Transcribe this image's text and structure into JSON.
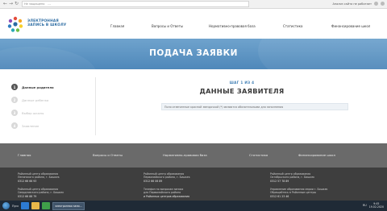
{
  "browser": {
    "back_icon": "arrow-left-icon",
    "forward_icon": "arrow-right-icon",
    "refresh_icon": "refresh-icon",
    "url_prefix": "Не защищено",
    "url": "...",
    "extension_label": "Анализ сайта не работает"
  },
  "logo": {
    "line1": "ЭЛЕКТРОННАЯ",
    "line2": "ЗАПИСЬ В ШКОЛУ"
  },
  "top_nav": [
    "Главная",
    "Вопросы и Ответы",
    "Нормативно-правовая база",
    "Статистика",
    "Финансирование школ"
  ],
  "banner": {
    "title": "ПОДАЧА ЗАЯВКИ"
  },
  "steps": [
    {
      "num": "1",
      "label": "Данные родителя",
      "active": true
    },
    {
      "num": "2",
      "label": "Данные ребенка",
      "active": false
    },
    {
      "num": "3",
      "label": "Выбор школы",
      "active": false
    },
    {
      "num": "4",
      "label": "Заявление",
      "active": false
    }
  ],
  "form": {
    "step_counter": "ШАГ 1 ИЗ 4",
    "title": "ДАННЫЕ ЗАЯВИТЕЛЯ",
    "notice": "Поля отмеченные красной звездочкой (*) являются обязательными для заполнения"
  },
  "footer_nav": [
    "Главная",
    "Вопросы и Ответы",
    "Нормативно-правовая база",
    "Статистика",
    "Финансирование школ"
  ],
  "footer_info": [
    {
      "lines": [
        "Районный центр образования",
        "Ленинского района, г. Бишкек"
      ],
      "phone": "0312 66 66 93"
    },
    {
      "lines": [
        "Районный центр образования",
        "Первомайского района, г. Бишкек"
      ],
      "phone": "0312 66 06 89"
    },
    {
      "lines": [
        "Районный центр образования",
        "Октябрьского района, г. Бишкек"
      ],
      "phone": "0312 57 78 89"
    }
  ],
  "footer_info_row2": [
    {
      "lines": [
        "Районный центр образования",
        "Свердловского района, г. Бишкек"
      ],
      "phone": "0312 66 88 79"
    },
    {
      "lines": [
        "Телефон по вопросам записи",
        "для Первомайского района"
      ],
      "phone": "и Районных центров образования"
    },
    {
      "lines": [
        "Управление образования мэрии г. Бишкек",
        "Обращайтесь в Районные центры"
      ],
      "phone": "0312 61 23 46"
    }
  ],
  "taskbar": {
    "start_label": "Пуск",
    "window_label": "электронная запи...",
    "lang": "RU",
    "time": "9:45",
    "date": "19.02.2020"
  },
  "colors": {
    "banner": "#5b93c3",
    "footer_nav": "#6a6a6a",
    "footer_info": "#3e3e3e",
    "accent": "#3f7eb4"
  }
}
